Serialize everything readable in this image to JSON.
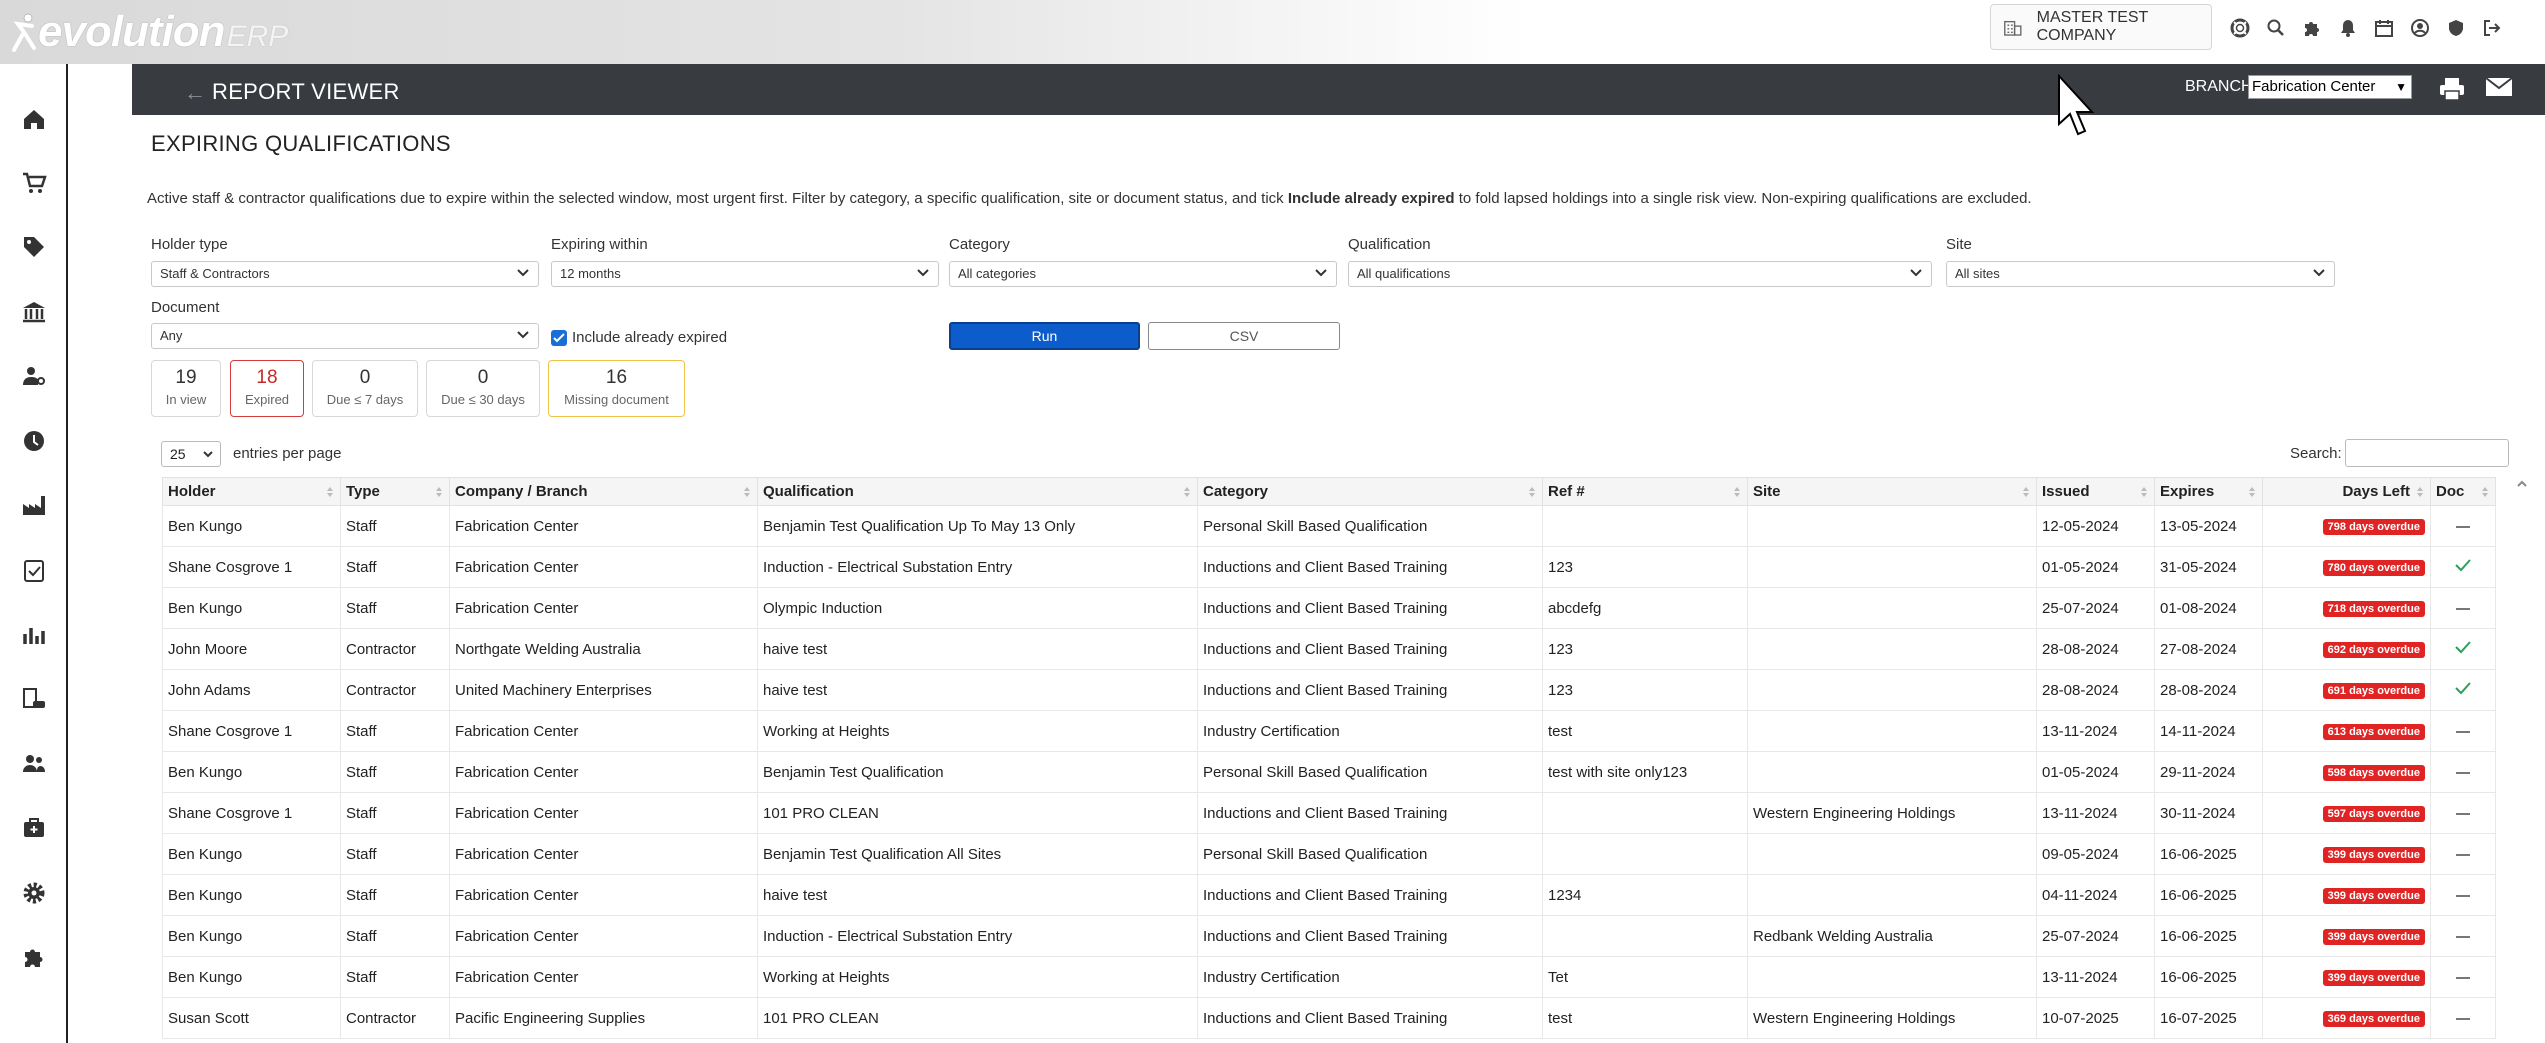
{
  "app": {
    "brand": "evolution",
    "brand_suffix": "ERP",
    "company": "MASTER TEST COMPANY"
  },
  "header": {
    "title": "REPORT VIEWER",
    "branch_label": "BRANCH:",
    "branch_value": "Fabrication Center"
  },
  "report": {
    "title": "EXPIRING QUALIFICATIONS",
    "intro_a": "Active staff & contractor qualifications due to expire within the selected window, most urgent first. Filter by category, a specific qualification, site or document status, and tick ",
    "intro_b": "Include already expired",
    "intro_c": " to fold lapsed holdings into a single risk view. Non-expiring qualifications are excluded."
  },
  "filters": {
    "holder_type": {
      "label": "Holder type",
      "value": "Staff & Contractors"
    },
    "expiring_within": {
      "label": "Expiring within",
      "value": "12 months"
    },
    "category": {
      "label": "Category",
      "value": "All categories"
    },
    "qualification": {
      "label": "Qualification",
      "value": "All qualifications"
    },
    "site": {
      "label": "Site",
      "value": "All sites"
    },
    "document": {
      "label": "Document",
      "value": "Any"
    },
    "include_expired": {
      "label": "Include already expired",
      "checked": true
    },
    "run_label": "Run",
    "csv_label": "CSV"
  },
  "stats": [
    {
      "value": "19",
      "label": "In view"
    },
    {
      "value": "18",
      "label": "Expired"
    },
    {
      "value": "0",
      "label": "Due ≤ 7 days"
    },
    {
      "value": "0",
      "label": "Due ≤ 30 days"
    },
    {
      "value": "16",
      "label": "Missing document"
    }
  ],
  "table_controls": {
    "page_length": "25",
    "page_length_label": "entries per page",
    "search_label": "Search:"
  },
  "columns": [
    "Holder",
    "Type",
    "Company / Branch",
    "Qualification",
    "Category",
    "Ref #",
    "Site",
    "Issued",
    "Expires",
    "Days Left",
    "Doc"
  ],
  "rows": [
    {
      "holder": "Ben Kungo",
      "type": "Staff",
      "company": "Fabrication Center",
      "qualification": "Benjamin Test Qualification Up To May 13 Only",
      "category": "Personal Skill Based Qualification",
      "ref": "",
      "site": "",
      "issued": "12-05-2024",
      "expires": "13-05-2024",
      "days_left": "798 days overdue",
      "doc": false
    },
    {
      "holder": "Shane Cosgrove 1",
      "type": "Staff",
      "company": "Fabrication Center",
      "qualification": "Induction - Electrical Substation Entry",
      "category": "Inductions and Client Based Training",
      "ref": "123",
      "site": "",
      "issued": "01-05-2024",
      "expires": "31-05-2024",
      "days_left": "780 days overdue",
      "doc": true
    },
    {
      "holder": "Ben Kungo",
      "type": "Staff",
      "company": "Fabrication Center",
      "qualification": "Olympic Induction",
      "category": "Inductions and Client Based Training",
      "ref": "abcdefg",
      "site": "",
      "issued": "25-07-2024",
      "expires": "01-08-2024",
      "days_left": "718 days overdue",
      "doc": false
    },
    {
      "holder": "John Moore",
      "type": "Contractor",
      "company": "Northgate Welding Australia",
      "qualification": "haive test",
      "category": "Inductions and Client Based Training",
      "ref": "123",
      "site": "",
      "issued": "28-08-2024",
      "expires": "27-08-2024",
      "days_left": "692 days overdue",
      "doc": true
    },
    {
      "holder": "John Adams",
      "type": "Contractor",
      "company": "United Machinery Enterprises",
      "qualification": "haive test",
      "category": "Inductions and Client Based Training",
      "ref": "123",
      "site": "",
      "issued": "28-08-2024",
      "expires": "28-08-2024",
      "days_left": "691 days overdue",
      "doc": true
    },
    {
      "holder": "Shane Cosgrove 1",
      "type": "Staff",
      "company": "Fabrication Center",
      "qualification": "Working at Heights",
      "category": "Industry Certification",
      "ref": "test",
      "site": "",
      "issued": "13-11-2024",
      "expires": "14-11-2024",
      "days_left": "613 days overdue",
      "doc": false
    },
    {
      "holder": "Ben Kungo",
      "type": "Staff",
      "company": "Fabrication Center",
      "qualification": "Benjamin Test Qualification",
      "category": "Personal Skill Based Qualification",
      "ref": "test with site only123",
      "site": "",
      "issued": "01-05-2024",
      "expires": "29-11-2024",
      "days_left": "598 days overdue",
      "doc": false
    },
    {
      "holder": "Shane Cosgrove 1",
      "type": "Staff",
      "company": "Fabrication Center",
      "qualification": "101 PRO CLEAN",
      "category": "Inductions and Client Based Training",
      "ref": "",
      "site": "Western Engineering Holdings",
      "issued": "13-11-2024",
      "expires": "30-11-2024",
      "days_left": "597 days overdue",
      "doc": false
    },
    {
      "holder": "Ben Kungo",
      "type": "Staff",
      "company": "Fabrication Center",
      "qualification": "Benjamin Test Qualification All Sites",
      "category": "Personal Skill Based Qualification",
      "ref": "",
      "site": "",
      "issued": "09-05-2024",
      "expires": "16-06-2025",
      "days_left": "399 days overdue",
      "doc": false
    },
    {
      "holder": "Ben Kungo",
      "type": "Staff",
      "company": "Fabrication Center",
      "qualification": "haive test",
      "category": "Inductions and Client Based Training",
      "ref": "1234",
      "site": "",
      "issued": "04-11-2024",
      "expires": "16-06-2025",
      "days_left": "399 days overdue",
      "doc": false
    },
    {
      "holder": "Ben Kungo",
      "type": "Staff",
      "company": "Fabrication Center",
      "qualification": "Induction - Electrical Substation Entry",
      "category": "Inductions and Client Based Training",
      "ref": "",
      "site": "Redbank Welding Australia",
      "issued": "25-07-2024",
      "expires": "16-06-2025",
      "days_left": "399 days overdue",
      "doc": false
    },
    {
      "holder": "Ben Kungo",
      "type": "Staff",
      "company": "Fabrication Center",
      "qualification": "Working at Heights",
      "category": "Industry Certification",
      "ref": "Tet",
      "site": "",
      "issued": "13-11-2024",
      "expires": "16-06-2025",
      "days_left": "399 days overdue",
      "doc": false
    },
    {
      "holder": "Susan Scott",
      "type": "Contractor",
      "company": "Pacific Engineering Supplies",
      "qualification": "101 PRO CLEAN",
      "category": "Inductions and Client Based Training",
      "ref": "test",
      "site": "Western Engineering Holdings",
      "issued": "10-07-2025",
      "expires": "16-07-2025",
      "days_left": "369 days overdue",
      "doc": false
    }
  ],
  "colors": {
    "accent": "#0d5ccb",
    "overdue": "#e02424",
    "header_band": "#383b40",
    "doc_check": "#2e9e5b"
  },
  "icons": {
    "sidebar": [
      "home-icon",
      "cart-icon",
      "tag-icon",
      "bank-icon",
      "user-gear-icon",
      "clock-icon",
      "factory-icon",
      "clipboard-check-icon",
      "bar-chart-icon",
      "building-car-icon",
      "users-icon",
      "briefcase-medical-icon",
      "gear-icon",
      "puzzle-icon"
    ],
    "top": [
      "lifebuoy-icon",
      "search-icon",
      "puzzle-icon",
      "bell-icon",
      "calendar-icon",
      "user-circle-icon",
      "shield-icon",
      "logout-icon"
    ]
  }
}
